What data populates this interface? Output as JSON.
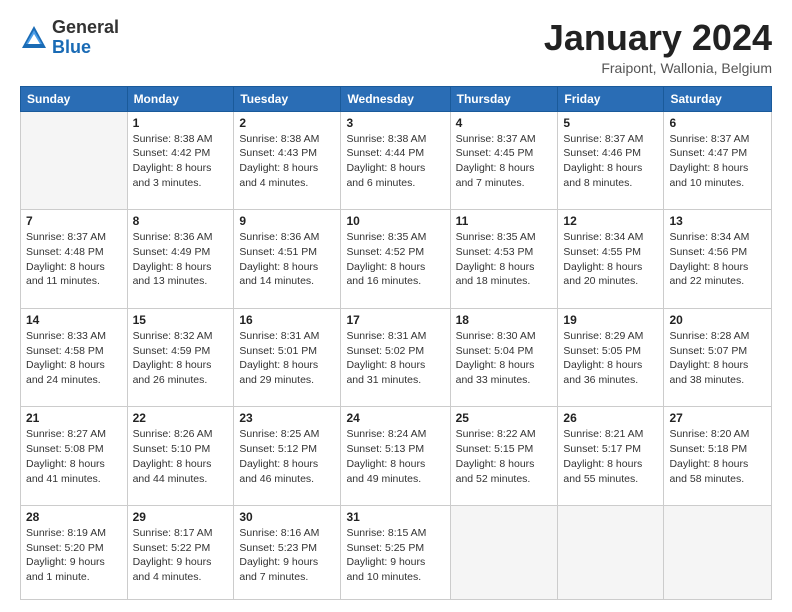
{
  "header": {
    "logo_general": "General",
    "logo_blue": "Blue",
    "month_title": "January 2024",
    "location": "Fraipont, Wallonia, Belgium"
  },
  "weekdays": [
    "Sunday",
    "Monday",
    "Tuesday",
    "Wednesday",
    "Thursday",
    "Friday",
    "Saturday"
  ],
  "weeks": [
    [
      {
        "day": "",
        "empty": true
      },
      {
        "day": "1",
        "sunrise": "Sunrise: 8:38 AM",
        "sunset": "Sunset: 4:42 PM",
        "daylight": "Daylight: 8 hours and 3 minutes."
      },
      {
        "day": "2",
        "sunrise": "Sunrise: 8:38 AM",
        "sunset": "Sunset: 4:43 PM",
        "daylight": "Daylight: 8 hours and 4 minutes."
      },
      {
        "day": "3",
        "sunrise": "Sunrise: 8:38 AM",
        "sunset": "Sunset: 4:44 PM",
        "daylight": "Daylight: 8 hours and 6 minutes."
      },
      {
        "day": "4",
        "sunrise": "Sunrise: 8:37 AM",
        "sunset": "Sunset: 4:45 PM",
        "daylight": "Daylight: 8 hours and 7 minutes."
      },
      {
        "day": "5",
        "sunrise": "Sunrise: 8:37 AM",
        "sunset": "Sunset: 4:46 PM",
        "daylight": "Daylight: 8 hours and 8 minutes."
      },
      {
        "day": "6",
        "sunrise": "Sunrise: 8:37 AM",
        "sunset": "Sunset: 4:47 PM",
        "daylight": "Daylight: 8 hours and 10 minutes."
      }
    ],
    [
      {
        "day": "7",
        "sunrise": "Sunrise: 8:37 AM",
        "sunset": "Sunset: 4:48 PM",
        "daylight": "Daylight: 8 hours and 11 minutes."
      },
      {
        "day": "8",
        "sunrise": "Sunrise: 8:36 AM",
        "sunset": "Sunset: 4:49 PM",
        "daylight": "Daylight: 8 hours and 13 minutes."
      },
      {
        "day": "9",
        "sunrise": "Sunrise: 8:36 AM",
        "sunset": "Sunset: 4:51 PM",
        "daylight": "Daylight: 8 hours and 14 minutes."
      },
      {
        "day": "10",
        "sunrise": "Sunrise: 8:35 AM",
        "sunset": "Sunset: 4:52 PM",
        "daylight": "Daylight: 8 hours and 16 minutes."
      },
      {
        "day": "11",
        "sunrise": "Sunrise: 8:35 AM",
        "sunset": "Sunset: 4:53 PM",
        "daylight": "Daylight: 8 hours and 18 minutes."
      },
      {
        "day": "12",
        "sunrise": "Sunrise: 8:34 AM",
        "sunset": "Sunset: 4:55 PM",
        "daylight": "Daylight: 8 hours and 20 minutes."
      },
      {
        "day": "13",
        "sunrise": "Sunrise: 8:34 AM",
        "sunset": "Sunset: 4:56 PM",
        "daylight": "Daylight: 8 hours and 22 minutes."
      }
    ],
    [
      {
        "day": "14",
        "sunrise": "Sunrise: 8:33 AM",
        "sunset": "Sunset: 4:58 PM",
        "daylight": "Daylight: 8 hours and 24 minutes."
      },
      {
        "day": "15",
        "sunrise": "Sunrise: 8:32 AM",
        "sunset": "Sunset: 4:59 PM",
        "daylight": "Daylight: 8 hours and 26 minutes."
      },
      {
        "day": "16",
        "sunrise": "Sunrise: 8:31 AM",
        "sunset": "Sunset: 5:01 PM",
        "daylight": "Daylight: 8 hours and 29 minutes."
      },
      {
        "day": "17",
        "sunrise": "Sunrise: 8:31 AM",
        "sunset": "Sunset: 5:02 PM",
        "daylight": "Daylight: 8 hours and 31 minutes."
      },
      {
        "day": "18",
        "sunrise": "Sunrise: 8:30 AM",
        "sunset": "Sunset: 5:04 PM",
        "daylight": "Daylight: 8 hours and 33 minutes."
      },
      {
        "day": "19",
        "sunrise": "Sunrise: 8:29 AM",
        "sunset": "Sunset: 5:05 PM",
        "daylight": "Daylight: 8 hours and 36 minutes."
      },
      {
        "day": "20",
        "sunrise": "Sunrise: 8:28 AM",
        "sunset": "Sunset: 5:07 PM",
        "daylight": "Daylight: 8 hours and 38 minutes."
      }
    ],
    [
      {
        "day": "21",
        "sunrise": "Sunrise: 8:27 AM",
        "sunset": "Sunset: 5:08 PM",
        "daylight": "Daylight: 8 hours and 41 minutes."
      },
      {
        "day": "22",
        "sunrise": "Sunrise: 8:26 AM",
        "sunset": "Sunset: 5:10 PM",
        "daylight": "Daylight: 8 hours and 44 minutes."
      },
      {
        "day": "23",
        "sunrise": "Sunrise: 8:25 AM",
        "sunset": "Sunset: 5:12 PM",
        "daylight": "Daylight: 8 hours and 46 minutes."
      },
      {
        "day": "24",
        "sunrise": "Sunrise: 8:24 AM",
        "sunset": "Sunset: 5:13 PM",
        "daylight": "Daylight: 8 hours and 49 minutes."
      },
      {
        "day": "25",
        "sunrise": "Sunrise: 8:22 AM",
        "sunset": "Sunset: 5:15 PM",
        "daylight": "Daylight: 8 hours and 52 minutes."
      },
      {
        "day": "26",
        "sunrise": "Sunrise: 8:21 AM",
        "sunset": "Sunset: 5:17 PM",
        "daylight": "Daylight: 8 hours and 55 minutes."
      },
      {
        "day": "27",
        "sunrise": "Sunrise: 8:20 AM",
        "sunset": "Sunset: 5:18 PM",
        "daylight": "Daylight: 8 hours and 58 minutes."
      }
    ],
    [
      {
        "day": "28",
        "sunrise": "Sunrise: 8:19 AM",
        "sunset": "Sunset: 5:20 PM",
        "daylight": "Daylight: 9 hours and 1 minute."
      },
      {
        "day": "29",
        "sunrise": "Sunrise: 8:17 AM",
        "sunset": "Sunset: 5:22 PM",
        "daylight": "Daylight: 9 hours and 4 minutes."
      },
      {
        "day": "30",
        "sunrise": "Sunrise: 8:16 AM",
        "sunset": "Sunset: 5:23 PM",
        "daylight": "Daylight: 9 hours and 7 minutes."
      },
      {
        "day": "31",
        "sunrise": "Sunrise: 8:15 AM",
        "sunset": "Sunset: 5:25 PM",
        "daylight": "Daylight: 9 hours and 10 minutes."
      },
      {
        "day": "",
        "empty": true
      },
      {
        "day": "",
        "empty": true
      },
      {
        "day": "",
        "empty": true
      }
    ]
  ]
}
